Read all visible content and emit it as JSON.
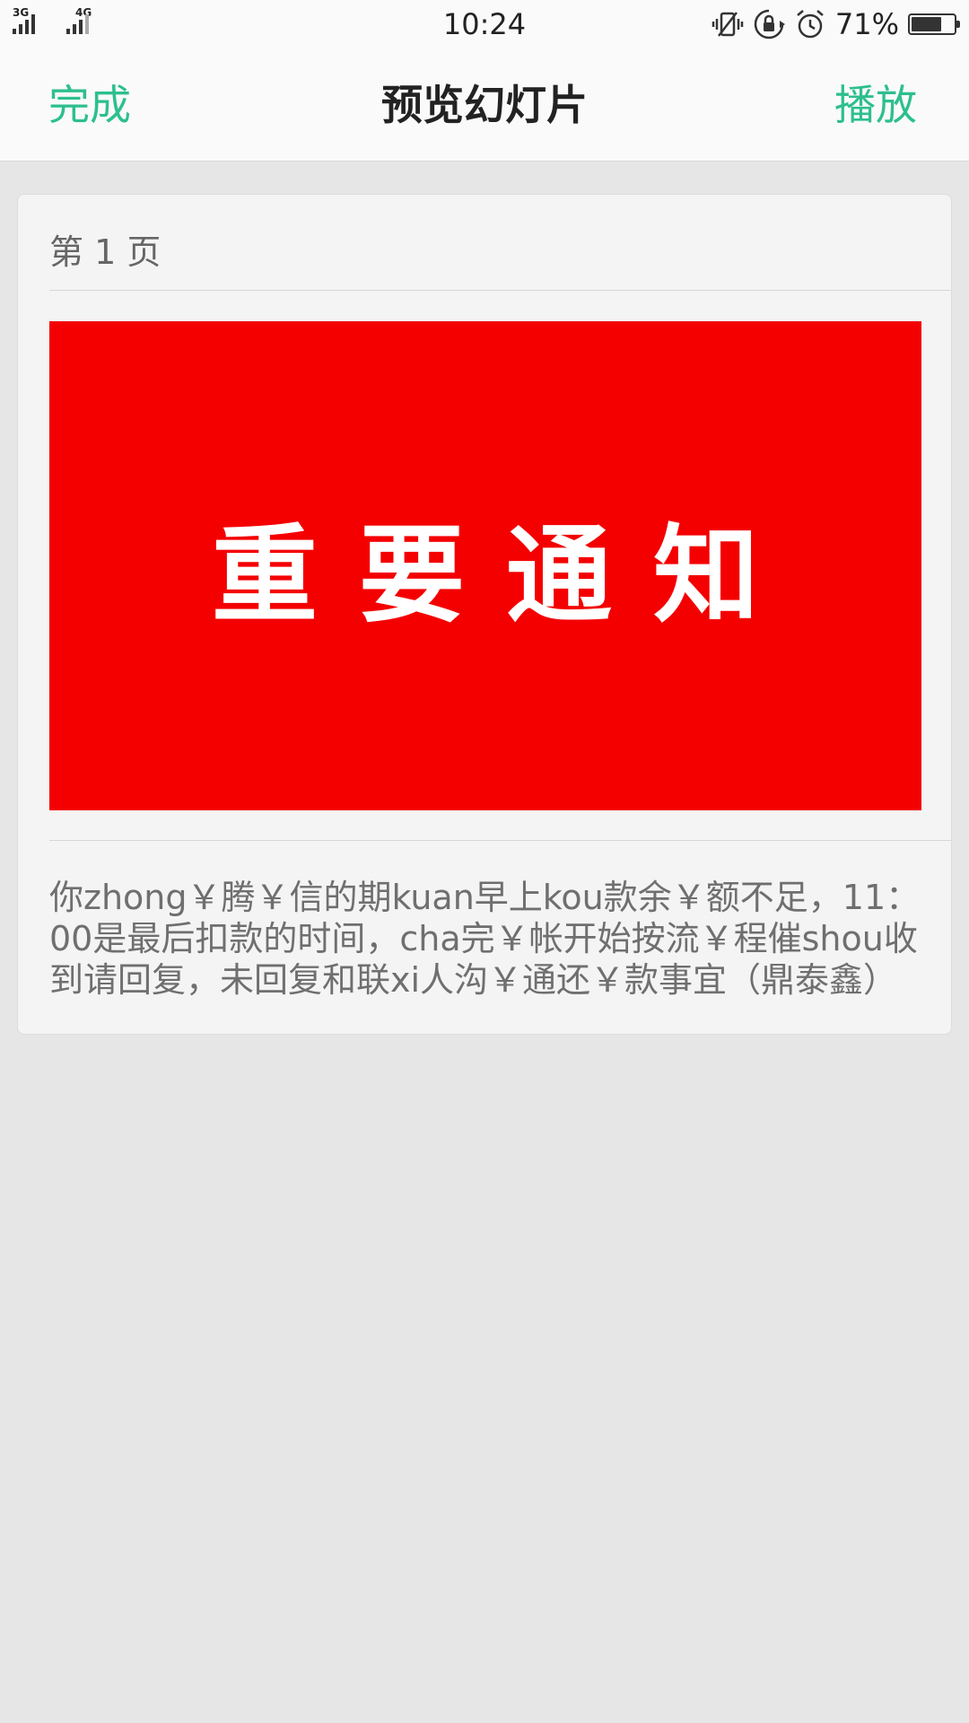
{
  "status_bar": {
    "network_1": "3G",
    "network_2": "4G",
    "time": "10:24",
    "battery_percent": "71%",
    "battery_level": 0.71,
    "icons": [
      "vibrate-icon",
      "rotation-lock-icon",
      "alarm-icon",
      "battery-icon"
    ]
  },
  "title_bar": {
    "done_label": "完成",
    "title": "预览幻灯片",
    "play_label": "播放"
  },
  "slide_card": {
    "page_label": "第 1 页",
    "slide_text": "重要通知",
    "slide_color": "#f40000",
    "note": "你zhong￥腾￥信的期kuan早上kou款余￥额不足，11：00是最后扣款的时间，cha完￥帐开始按流￥程催shou收到请回复，未回复和联xi人沟￥通还￥款事宜（鼎泰鑫）"
  },
  "colors": {
    "accent": "#2dbf8f",
    "background": "#e6e6e6"
  }
}
